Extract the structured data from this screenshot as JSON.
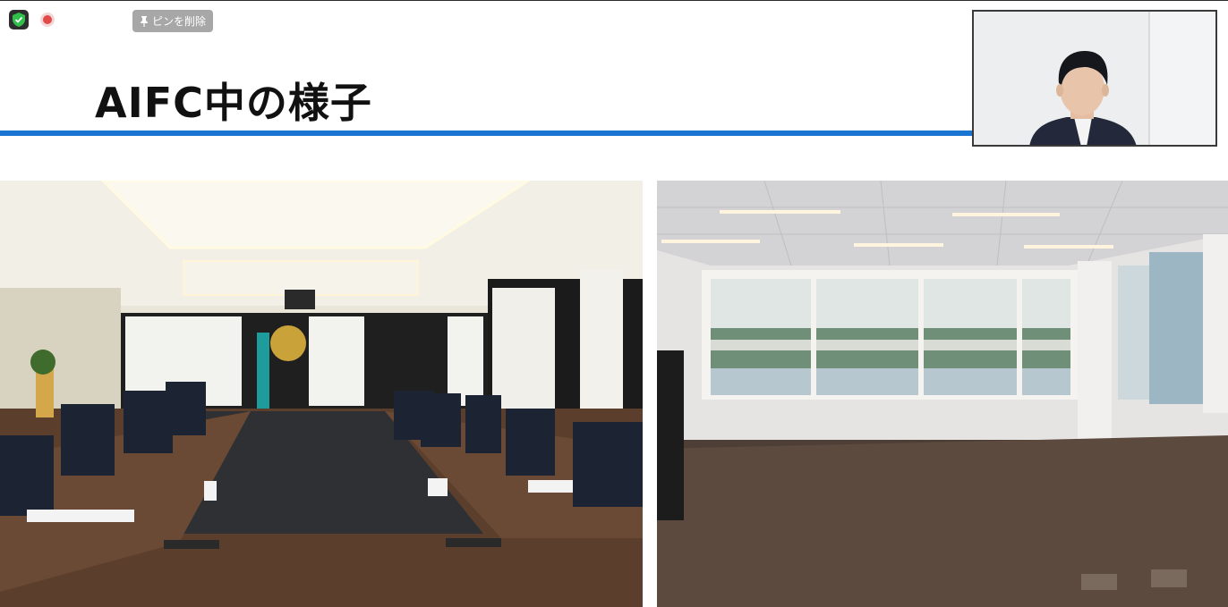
{
  "app": {
    "unpin_label": "ピンを削除"
  },
  "slide": {
    "title": "AIFC中の様子"
  },
  "icons": {
    "security": "shield-check-icon",
    "record": "record-icon",
    "pin": "pin-icon"
  },
  "colors": {
    "accent_rule": "#1a75d2",
    "security_green": "#2fbf4a",
    "record_red": "#e24a4a"
  }
}
